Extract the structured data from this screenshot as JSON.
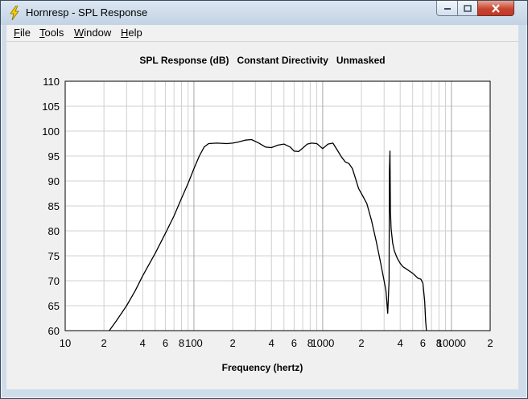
{
  "window": {
    "title": "Hornresp - SPL Response"
  },
  "menu": {
    "items": [
      {
        "mnemonic": "F",
        "rest": "ile"
      },
      {
        "mnemonic": "T",
        "rest": "ools"
      },
      {
        "mnemonic": "W",
        "rest": "indow"
      },
      {
        "mnemonic": "H",
        "rest": "elp"
      }
    ]
  },
  "icons": {
    "app": "lightning-bolt-icon",
    "minimize": "minimize-icon",
    "maximize": "maximize-icon",
    "close": "close-icon"
  },
  "colors": {
    "plot_background": "#ffffff",
    "grid": "#d0d0d0",
    "curve": "#000000",
    "close_button": "#c8452e"
  },
  "chart_data": {
    "type": "line",
    "title": "SPL Response (dB)   Constant Directivity   Unmasked",
    "xlabel": "Frequency (hertz)",
    "ylabel": "",
    "x_scale": "log",
    "xlim": [
      10,
      20000
    ],
    "ylim": [
      60,
      110
    ],
    "grid": true,
    "y_ticks": [
      "60",
      "65",
      "70",
      "75",
      "80",
      "85",
      "90",
      "95",
      "100",
      "105",
      "110"
    ],
    "x_ticks": [
      {
        "value": 10,
        "label": "10"
      },
      {
        "value": 20,
        "label": "2"
      },
      {
        "value": 40,
        "label": "4"
      },
      {
        "value": 60,
        "label": "6"
      },
      {
        "value": 80,
        "label": "8"
      },
      {
        "value": 100,
        "label": "100"
      },
      {
        "value": 200,
        "label": "2"
      },
      {
        "value": 400,
        "label": "4"
      },
      {
        "value": 600,
        "label": "6"
      },
      {
        "value": 800,
        "label": "8"
      },
      {
        "value": 1000,
        "label": "1000"
      },
      {
        "value": 2000,
        "label": "2"
      },
      {
        "value": 4000,
        "label": "4"
      },
      {
        "value": 6000,
        "label": "6"
      },
      {
        "value": 8000,
        "label": "8"
      },
      {
        "value": 10000,
        "label": "10000"
      },
      {
        "value": 20000,
        "label": "2"
      }
    ],
    "series": [
      {
        "x": [
          22,
          25,
          30,
          35,
          40,
          50,
          60,
          70,
          80,
          90,
          100,
          110,
          120,
          130,
          150,
          180,
          200,
          220,
          250,
          280,
          320,
          360,
          400,
          450,
          500,
          560,
          600,
          650,
          700,
          760,
          820,
          900,
          1000,
          1100,
          1200,
          1300,
          1400,
          1500,
          1600,
          1700,
          1800,
          1900,
          2000,
          2200,
          2400,
          2600,
          2800,
          3000,
          3100,
          3200,
          3280,
          3300,
          3330,
          3360,
          3400,
          3450,
          3500,
          3600,
          3800,
          4000,
          4200,
          4500,
          5000,
          5500,
          5800,
          6000,
          6200,
          6300,
          6400
        ],
        "y": [
          60,
          62,
          65,
          68,
          71,
          75.5,
          79.5,
          83,
          86.5,
          89.5,
          92.5,
          95,
          96.8,
          97.5,
          97.6,
          97.5,
          97.6,
          97.8,
          98.2,
          98.3,
          97.6,
          96.8,
          96.7,
          97.2,
          97.4,
          96.8,
          96.0,
          95.9,
          96.6,
          97.4,
          97.6,
          97.5,
          96.5,
          97.4,
          97.6,
          96.2,
          94.8,
          93.8,
          93.5,
          92.5,
          90.5,
          88.5,
          87.5,
          85.5,
          82,
          78,
          74,
          70,
          68,
          63.5,
          70,
          92,
          96,
          84,
          80.5,
          79,
          77.5,
          76,
          74.5,
          73.5,
          72.8,
          72.3,
          71.5,
          70.5,
          70.3,
          69.5,
          66,
          62,
          60
        ]
      }
    ]
  }
}
